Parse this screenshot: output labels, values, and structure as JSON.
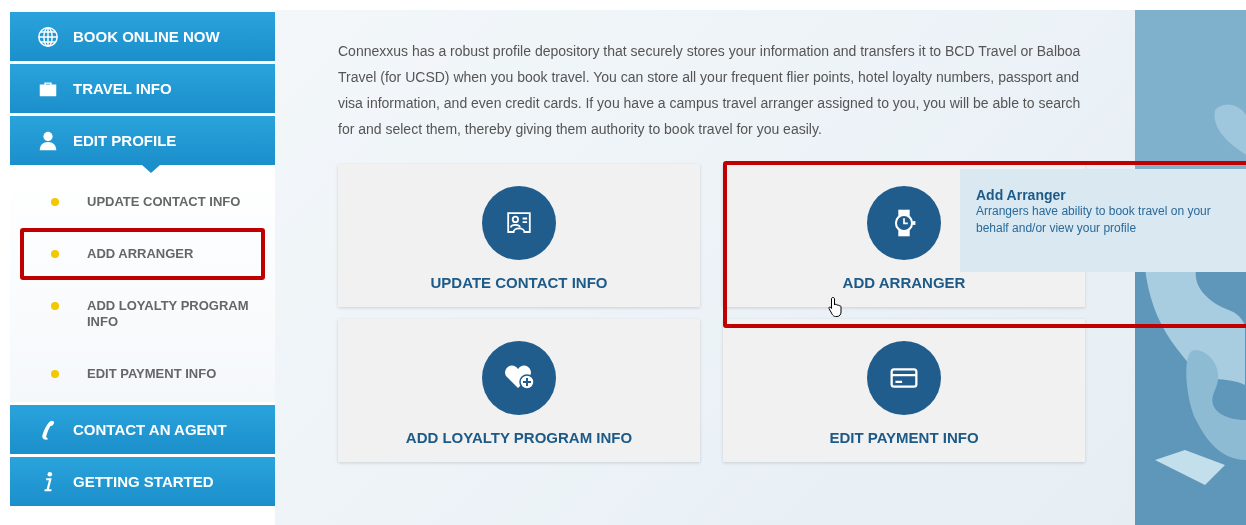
{
  "sidebar": {
    "items": [
      {
        "label": "BOOK ONLINE NOW",
        "expanded": false
      },
      {
        "label": "TRAVEL INFO",
        "expanded": false
      },
      {
        "label": "EDIT PROFILE",
        "expanded": true,
        "children": [
          {
            "label": "UPDATE CONTACT INFO",
            "highlighted": false
          },
          {
            "label": "ADD ARRANGER",
            "highlighted": true
          },
          {
            "label": "ADD LOYALTY PROGRAM INFO",
            "highlighted": false
          },
          {
            "label": "EDIT PAYMENT INFO",
            "highlighted": false
          }
        ]
      },
      {
        "label": "CONTACT AN AGENT",
        "expanded": false
      },
      {
        "label": "GETTING STARTED",
        "expanded": false
      }
    ]
  },
  "intro": "Connexxus has a robust profile depository that securely stores your information and transfers it to BCD Travel or Balboa Travel (for UCSD) when you book travel. You can store all your frequent flier points, hotel loyalty numbers, passport and visa information, and even credit cards. If you have a campus travel arranger assigned to you, you will be able to search for and select them, thereby giving them authority to book travel for you easily.",
  "cards": [
    {
      "label": "UPDATE CONTACT INFO",
      "highlighted": false
    },
    {
      "label": "ADD ARRANGER",
      "highlighted": true,
      "tooltip": {
        "title": "Add Arranger",
        "text": "Arrangers have ability to book travel on your behalf and/or view your profile"
      }
    },
    {
      "label": "ADD LOYALTY PROGRAM INFO",
      "highlighted": false
    },
    {
      "label": "EDIT PAYMENT INFO",
      "highlighted": false
    }
  ]
}
